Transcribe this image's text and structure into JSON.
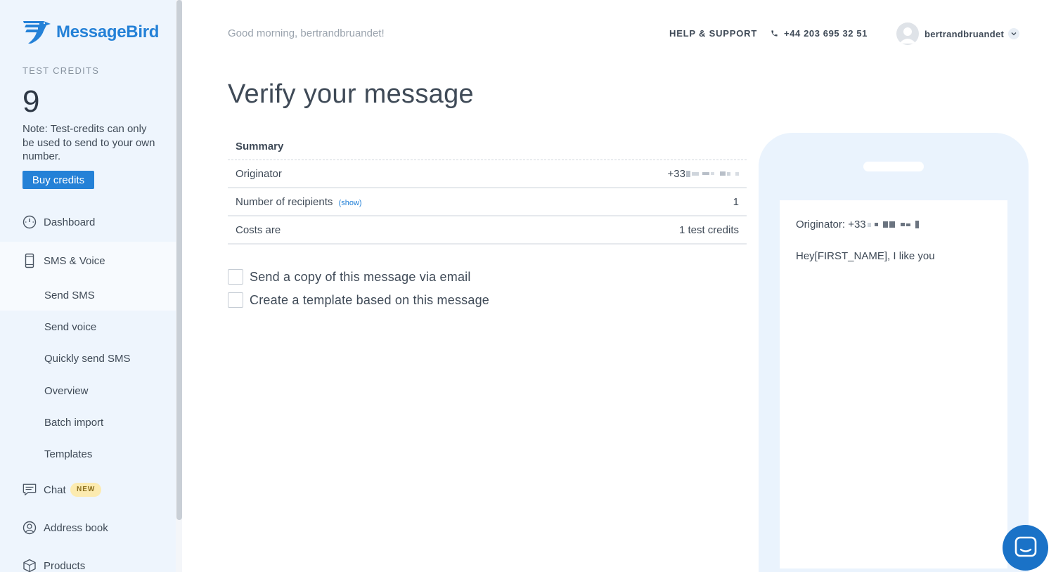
{
  "brand": {
    "name": "MessageBird",
    "color": "#2481d7"
  },
  "sidebar": {
    "credits_label": "TEST CREDITS",
    "credits_value": "9",
    "credits_note": "Note: Test-credits can only be used to send to your own number.",
    "buy_credits": "Buy credits",
    "nav": {
      "dashboard": {
        "label": "Dashboard",
        "icon": "gauge-icon"
      },
      "sms_voice": {
        "label": "SMS & Voice",
        "icon": "mobile-phone-icon"
      },
      "chat": {
        "label": "Chat",
        "icon": "chat-bubble-icon",
        "badge": "NEW"
      },
      "address_book": {
        "label": "Address book",
        "icon": "user-circle-icon"
      },
      "products": {
        "label": "Products",
        "icon": "box-icon"
      }
    },
    "sub_items": [
      "Send SMS",
      "Send voice",
      "Quickly send SMS",
      "Overview",
      "Batch import",
      "Templates"
    ]
  },
  "header": {
    "greeting": "Good morning, bertrandbruandet!",
    "help": "HELP & SUPPORT",
    "phone": "+44 203 695 32 51",
    "username": "bertrandbruandet"
  },
  "main": {
    "title": "Verify your message",
    "summary": {
      "heading": "Summary",
      "rows": [
        {
          "label": "Originator",
          "value": "+33"
        },
        {
          "label": "Number of recipients",
          "link": "(show)",
          "value": "1"
        },
        {
          "label": "Costs are",
          "value": "1 test credits"
        }
      ]
    },
    "options": {
      "email_copy": "Send a copy of this message via email",
      "template": "Create a template based on this message"
    }
  },
  "preview": {
    "originator_label": "Originator: +33",
    "body": "Hey[FIRST_NAME], I like you"
  }
}
